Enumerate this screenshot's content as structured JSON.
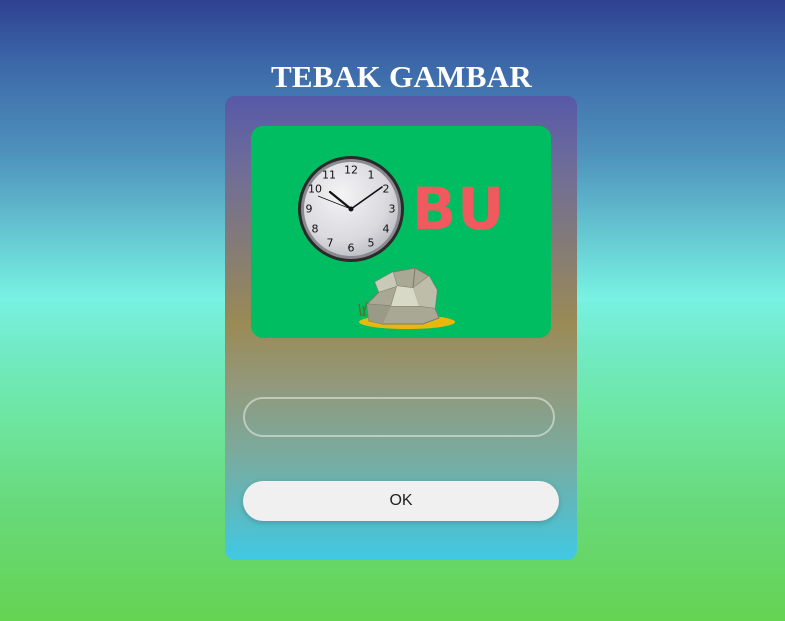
{
  "page": {
    "title": "TEBAK GAMBAR"
  },
  "puzzle": {
    "clue_icon_1": "clock-icon",
    "clue_text": "BU",
    "clue_icon_2": "rock-icon",
    "colors": {
      "picture_background": "#00bd62",
      "clue_text": "#f05a5e"
    }
  },
  "answer": {
    "value": "",
    "placeholder": ""
  },
  "actions": {
    "ok_label": "OK"
  },
  "colors": {
    "gradient_top": "#2e4191",
    "gradient_mid": "#78f2e2",
    "gradient_bottom": "#65d352",
    "button_background": "#f0f0f0"
  }
}
